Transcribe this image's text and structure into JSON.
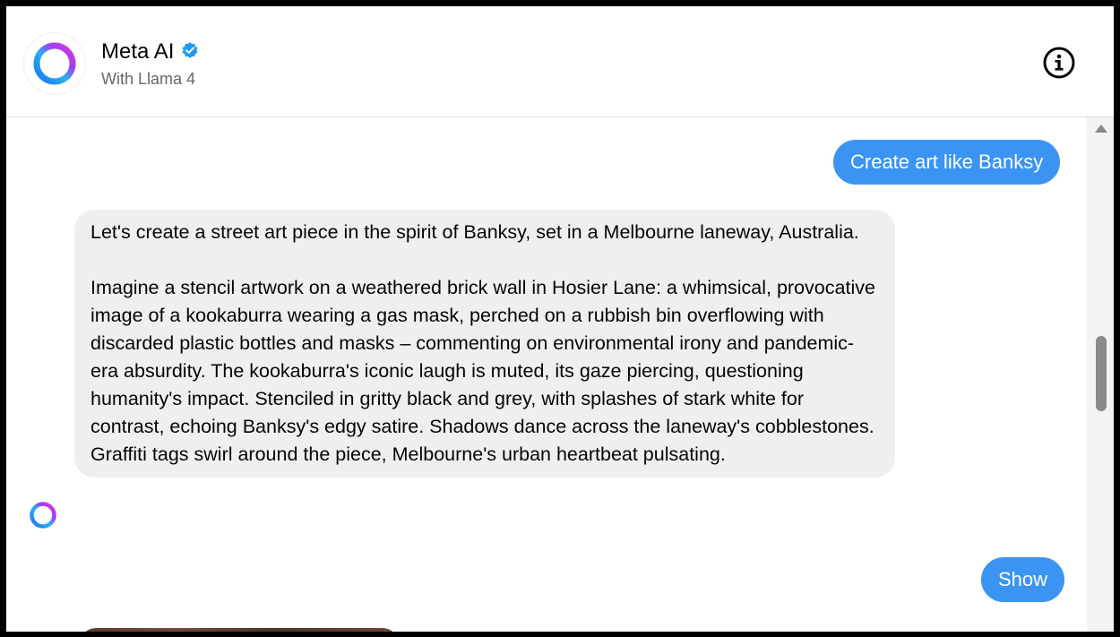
{
  "header": {
    "title": "Meta AI",
    "subtitle": "With Llama 4",
    "verified_icon": "verified-badge-icon",
    "info_icon": "info-icon"
  },
  "messages": {
    "user_1": "Create art like Banksy",
    "ai_1": {
      "paragraph_1": "Let's create a street art piece in the spirit of Banksy, set in a Melbourne laneway, Australia.",
      "paragraph_2": "Imagine a stencil artwork on a weathered brick wall in Hosier Lane: a whimsical, provocative image of a kookaburra wearing a gas mask, perched on a rubbish bin overflowing with discarded plastic bottles and masks – commenting on environmental irony and pandemic-era absurdity. The kookaburra's iconic laugh is muted, its gaze piercing, questioning humanity's impact. Stenciled in gritty black and grey, with splashes of stark white for contrast, echoing Banksy's edgy satire. Shadows dance across the laneway's cobblestones. Graffiti tags swirl around the piece, Melbourne's urban heartbeat pulsating."
    },
    "user_2": "Show"
  },
  "colors": {
    "user_bubble": "#3b94f2",
    "ai_bubble": "#efefef",
    "verified": "#1d9bf0"
  }
}
